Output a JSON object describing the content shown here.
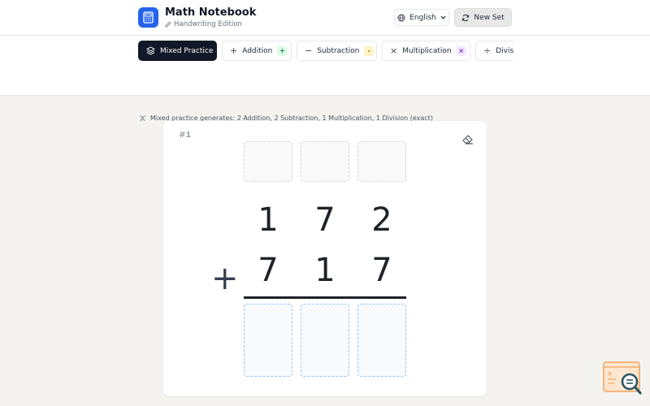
{
  "app": {
    "title": "Math Notebook",
    "subtitle": "Handwriting Edition"
  },
  "header": {
    "language_label": "English",
    "new_set_label": "New Set"
  },
  "tabs": [
    {
      "label": "Mixed Practice",
      "icon": "layers-icon",
      "active": true
    },
    {
      "label": "Addition",
      "icon": "plus-icon",
      "badge": "+",
      "badge_color": "#dcfce7"
    },
    {
      "label": "Subtraction",
      "icon": "minus-icon",
      "badge": "-",
      "badge_color": "#fef3c7"
    },
    {
      "label": "Multiplication",
      "icon": "times-icon",
      "badge": "×",
      "badge_color": "#f3e8ff"
    },
    {
      "label": "Divis",
      "icon": "divide-icon"
    }
  ],
  "note": "Mixed practice generates: 2 Addition, 2 Subtraction, 1 Multiplication, 1 Division (exact)",
  "problem": {
    "number": "#1",
    "operator": "+",
    "top_digits": [
      "1",
      "7",
      "2"
    ],
    "bottom_digits": [
      "7",
      "1",
      "7"
    ]
  },
  "colors": {
    "accent": "#2563eb",
    "active_tab": "#111827",
    "answer_border": "#93c5fd",
    "page_bg": "#f4f3ef"
  }
}
